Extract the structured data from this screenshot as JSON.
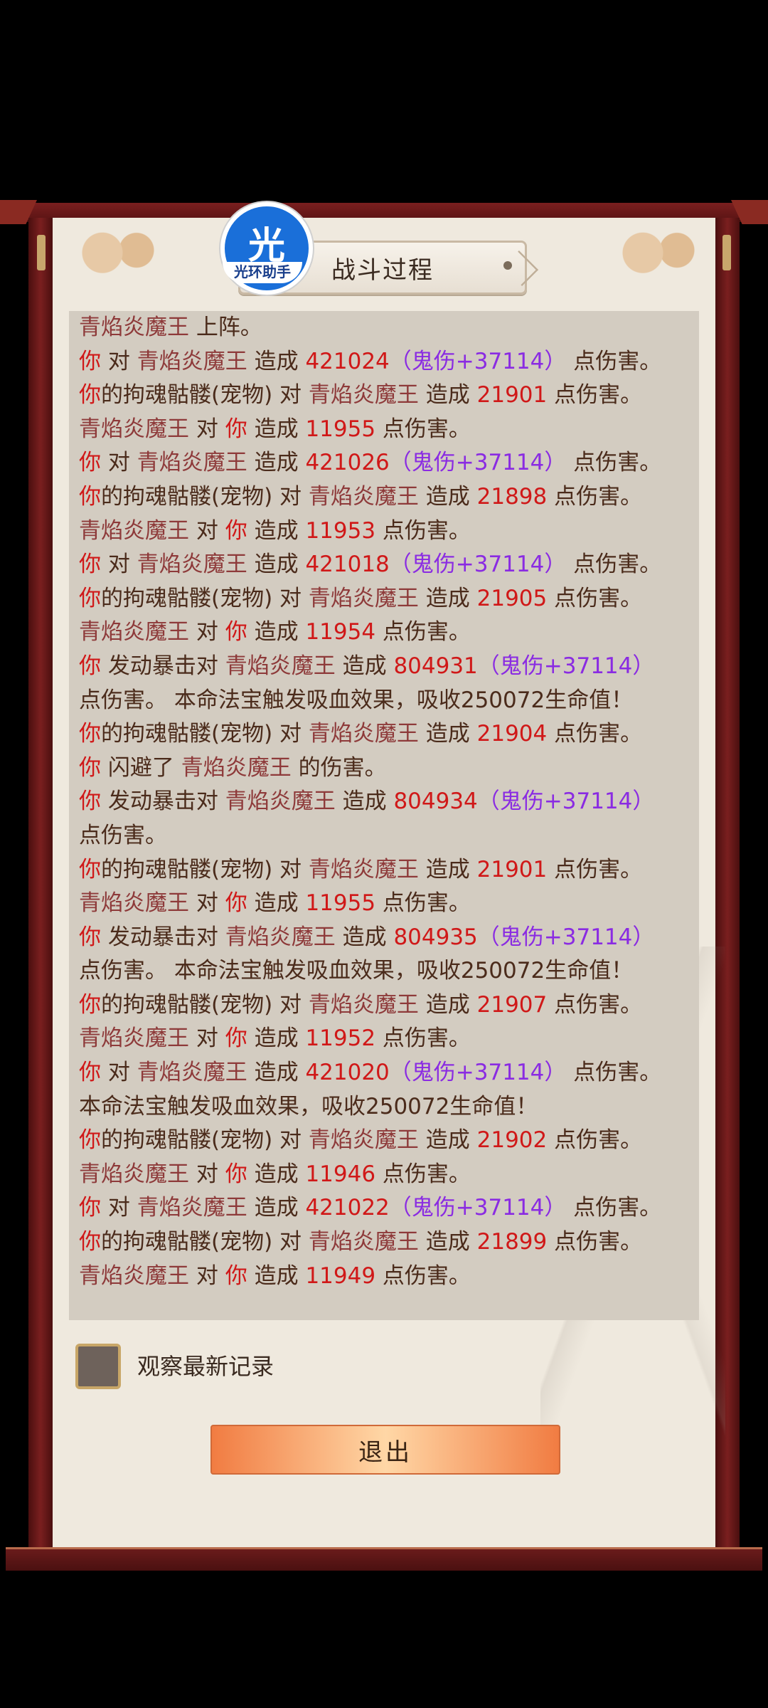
{
  "header": {
    "title": "战斗过程",
    "logo_glyph": "光",
    "logo_label": "光环助手"
  },
  "log": [
    [
      {
        "t": "青焰炎魔王",
        "c": "enemy"
      },
      {
        "t": " 上阵。",
        "c": "txt"
      }
    ],
    [
      {
        "t": "你",
        "c": "self"
      },
      {
        "t": " 对 ",
        "c": "txt"
      },
      {
        "t": "青焰炎魔王",
        "c": "enemy"
      },
      {
        "t": " 造成 ",
        "c": "txt"
      },
      {
        "t": "421024",
        "c": "dmg"
      },
      {
        "t": "（鬼伤+37114）",
        "c": "ghost"
      },
      {
        "t": " 点伤害。",
        "c": "txt"
      }
    ],
    [
      {
        "t": "你",
        "c": "self"
      },
      {
        "t": "的拘魂骷髅(宠物) 对 ",
        "c": "txt"
      },
      {
        "t": "青焰炎魔王",
        "c": "enemy"
      },
      {
        "t": " 造成 ",
        "c": "txt"
      },
      {
        "t": "21901",
        "c": "dmg"
      },
      {
        "t": " 点伤害。",
        "c": "txt"
      }
    ],
    [
      {
        "t": "青焰炎魔王",
        "c": "enemy"
      },
      {
        "t": " 对 ",
        "c": "txt"
      },
      {
        "t": "你",
        "c": "self"
      },
      {
        "t": " 造成 ",
        "c": "txt"
      },
      {
        "t": "11955",
        "c": "dmg"
      },
      {
        "t": " 点伤害。",
        "c": "txt"
      }
    ],
    [
      {
        "t": "你",
        "c": "self"
      },
      {
        "t": " 对 ",
        "c": "txt"
      },
      {
        "t": "青焰炎魔王",
        "c": "enemy"
      },
      {
        "t": " 造成 ",
        "c": "txt"
      },
      {
        "t": "421026",
        "c": "dmg"
      },
      {
        "t": "（鬼伤+37114）",
        "c": "ghost"
      },
      {
        "t": " 点伤害。",
        "c": "txt"
      }
    ],
    [
      {
        "t": "你",
        "c": "self"
      },
      {
        "t": "的拘魂骷髅(宠物) 对 ",
        "c": "txt"
      },
      {
        "t": "青焰炎魔王",
        "c": "enemy"
      },
      {
        "t": " 造成 ",
        "c": "txt"
      },
      {
        "t": "21898",
        "c": "dmg"
      },
      {
        "t": " 点伤害。",
        "c": "txt"
      }
    ],
    [
      {
        "t": "青焰炎魔王",
        "c": "enemy"
      },
      {
        "t": " 对 ",
        "c": "txt"
      },
      {
        "t": "你",
        "c": "self"
      },
      {
        "t": " 造成 ",
        "c": "txt"
      },
      {
        "t": "11953",
        "c": "dmg"
      },
      {
        "t": " 点伤害。",
        "c": "txt"
      }
    ],
    [
      {
        "t": "你",
        "c": "self"
      },
      {
        "t": " 对 ",
        "c": "txt"
      },
      {
        "t": "青焰炎魔王",
        "c": "enemy"
      },
      {
        "t": " 造成 ",
        "c": "txt"
      },
      {
        "t": "421018",
        "c": "dmg"
      },
      {
        "t": "（鬼伤+37114）",
        "c": "ghost"
      },
      {
        "t": " 点伤害。",
        "c": "txt"
      }
    ],
    [
      {
        "t": "你",
        "c": "self"
      },
      {
        "t": "的拘魂骷髅(宠物) 对 ",
        "c": "txt"
      },
      {
        "t": "青焰炎魔王",
        "c": "enemy"
      },
      {
        "t": " 造成 ",
        "c": "txt"
      },
      {
        "t": "21905",
        "c": "dmg"
      },
      {
        "t": " 点伤害。",
        "c": "txt"
      }
    ],
    [
      {
        "t": "青焰炎魔王",
        "c": "enemy"
      },
      {
        "t": " 对 ",
        "c": "txt"
      },
      {
        "t": "你",
        "c": "self"
      },
      {
        "t": " 造成 ",
        "c": "txt"
      },
      {
        "t": "11954",
        "c": "dmg"
      },
      {
        "t": " 点伤害。",
        "c": "txt"
      }
    ],
    [
      {
        "t": "你",
        "c": "self"
      },
      {
        "t": " 发动暴击对 ",
        "c": "txt"
      },
      {
        "t": "青焰炎魔王",
        "c": "enemy"
      },
      {
        "t": " 造成 ",
        "c": "txt"
      },
      {
        "t": "804931",
        "c": "dmg"
      },
      {
        "t": "（鬼伤+37114）",
        "c": "ghost"
      }
    ],
    [
      {
        "t": "点伤害。 本命法宝触发吸血效果，吸收250072生命值！",
        "c": "txt"
      }
    ],
    [
      {
        "t": "你",
        "c": "self"
      },
      {
        "t": "的拘魂骷髅(宠物) 对 ",
        "c": "txt"
      },
      {
        "t": "青焰炎魔王",
        "c": "enemy"
      },
      {
        "t": " 造成 ",
        "c": "txt"
      },
      {
        "t": "21904",
        "c": "dmg"
      },
      {
        "t": " 点伤害。",
        "c": "txt"
      }
    ],
    [
      {
        "t": "你",
        "c": "self"
      },
      {
        "t": " 闪避了 ",
        "c": "txt"
      },
      {
        "t": "青焰炎魔王",
        "c": "enemy"
      },
      {
        "t": " 的伤害。",
        "c": "txt"
      }
    ],
    [
      {
        "t": "你",
        "c": "self"
      },
      {
        "t": " 发动暴击对 ",
        "c": "txt"
      },
      {
        "t": "青焰炎魔王",
        "c": "enemy"
      },
      {
        "t": " 造成 ",
        "c": "txt"
      },
      {
        "t": "804934",
        "c": "dmg"
      },
      {
        "t": "（鬼伤+37114）",
        "c": "ghost"
      }
    ],
    [
      {
        "t": "点伤害。",
        "c": "txt"
      }
    ],
    [
      {
        "t": "你",
        "c": "self"
      },
      {
        "t": "的拘魂骷髅(宠物) 对 ",
        "c": "txt"
      },
      {
        "t": "青焰炎魔王",
        "c": "enemy"
      },
      {
        "t": " 造成 ",
        "c": "txt"
      },
      {
        "t": "21901",
        "c": "dmg"
      },
      {
        "t": " 点伤害。",
        "c": "txt"
      }
    ],
    [
      {
        "t": "青焰炎魔王",
        "c": "enemy"
      },
      {
        "t": " 对 ",
        "c": "txt"
      },
      {
        "t": "你",
        "c": "self"
      },
      {
        "t": " 造成 ",
        "c": "txt"
      },
      {
        "t": "11955",
        "c": "dmg"
      },
      {
        "t": " 点伤害。",
        "c": "txt"
      }
    ],
    [
      {
        "t": "你",
        "c": "self"
      },
      {
        "t": " 发动暴击对 ",
        "c": "txt"
      },
      {
        "t": "青焰炎魔王",
        "c": "enemy"
      },
      {
        "t": " 造成 ",
        "c": "txt"
      },
      {
        "t": "804935",
        "c": "dmg"
      },
      {
        "t": "（鬼伤+37114）",
        "c": "ghost"
      }
    ],
    [
      {
        "t": "点伤害。 本命法宝触发吸血效果，吸收250072生命值！",
        "c": "txt"
      }
    ],
    [
      {
        "t": "你",
        "c": "self"
      },
      {
        "t": "的拘魂骷髅(宠物) 对 ",
        "c": "txt"
      },
      {
        "t": "青焰炎魔王",
        "c": "enemy"
      },
      {
        "t": " 造成 ",
        "c": "txt"
      },
      {
        "t": "21907",
        "c": "dmg"
      },
      {
        "t": " 点伤害。",
        "c": "txt"
      }
    ],
    [
      {
        "t": "青焰炎魔王",
        "c": "enemy"
      },
      {
        "t": " 对 ",
        "c": "txt"
      },
      {
        "t": "你",
        "c": "self"
      },
      {
        "t": " 造成 ",
        "c": "txt"
      },
      {
        "t": "11952",
        "c": "dmg"
      },
      {
        "t": " 点伤害。",
        "c": "txt"
      }
    ],
    [
      {
        "t": "你",
        "c": "self"
      },
      {
        "t": " 对 ",
        "c": "txt"
      },
      {
        "t": "青焰炎魔王",
        "c": "enemy"
      },
      {
        "t": " 造成 ",
        "c": "txt"
      },
      {
        "t": "421020",
        "c": "dmg"
      },
      {
        "t": "（鬼伤+37114）",
        "c": "ghost"
      },
      {
        "t": " 点伤害。",
        "c": "txt"
      }
    ],
    [
      {
        "t": "本命法宝触发吸血效果，吸收250072生命值！",
        "c": "txt"
      }
    ],
    [
      {
        "t": "你",
        "c": "self"
      },
      {
        "t": "的拘魂骷髅(宠物) 对 ",
        "c": "txt"
      },
      {
        "t": "青焰炎魔王",
        "c": "enemy"
      },
      {
        "t": " 造成 ",
        "c": "txt"
      },
      {
        "t": "21902",
        "c": "dmg"
      },
      {
        "t": " 点伤害。",
        "c": "txt"
      }
    ],
    [
      {
        "t": "青焰炎魔王",
        "c": "enemy"
      },
      {
        "t": " 对 ",
        "c": "txt"
      },
      {
        "t": "你",
        "c": "self"
      },
      {
        "t": " 造成 ",
        "c": "txt"
      },
      {
        "t": "11946",
        "c": "dmg"
      },
      {
        "t": " 点伤害。",
        "c": "txt"
      }
    ],
    [
      {
        "t": "你",
        "c": "self"
      },
      {
        "t": " 对 ",
        "c": "txt"
      },
      {
        "t": "青焰炎魔王",
        "c": "enemy"
      },
      {
        "t": " 造成 ",
        "c": "txt"
      },
      {
        "t": "421022",
        "c": "dmg"
      },
      {
        "t": "（鬼伤+37114）",
        "c": "ghost"
      },
      {
        "t": " 点伤害。",
        "c": "txt"
      }
    ],
    [
      {
        "t": "你",
        "c": "self"
      },
      {
        "t": "的拘魂骷髅(宠物) 对 ",
        "c": "txt"
      },
      {
        "t": "青焰炎魔王",
        "c": "enemy"
      },
      {
        "t": " 造成 ",
        "c": "txt"
      },
      {
        "t": "21899",
        "c": "dmg"
      },
      {
        "t": " 点伤害。",
        "c": "txt"
      }
    ],
    [
      {
        "t": "青焰炎魔王",
        "c": "enemy"
      },
      {
        "t": " 对 ",
        "c": "txt"
      },
      {
        "t": "你",
        "c": "self"
      },
      {
        "t": " 造成 ",
        "c": "txt"
      },
      {
        "t": "11949",
        "c": "dmg"
      },
      {
        "t": " 点伤害。",
        "c": "txt"
      }
    ]
  ],
  "controls": {
    "watch_latest_label": "观察最新记录",
    "watch_latest_checked": false,
    "exit_label": "退出"
  },
  "colors": {
    "self": "#d01818",
    "enemy": "#8e3a3a",
    "damage": "#d01818",
    "ghost_damage": "#8a2be2",
    "text": "#4b2b1b"
  }
}
